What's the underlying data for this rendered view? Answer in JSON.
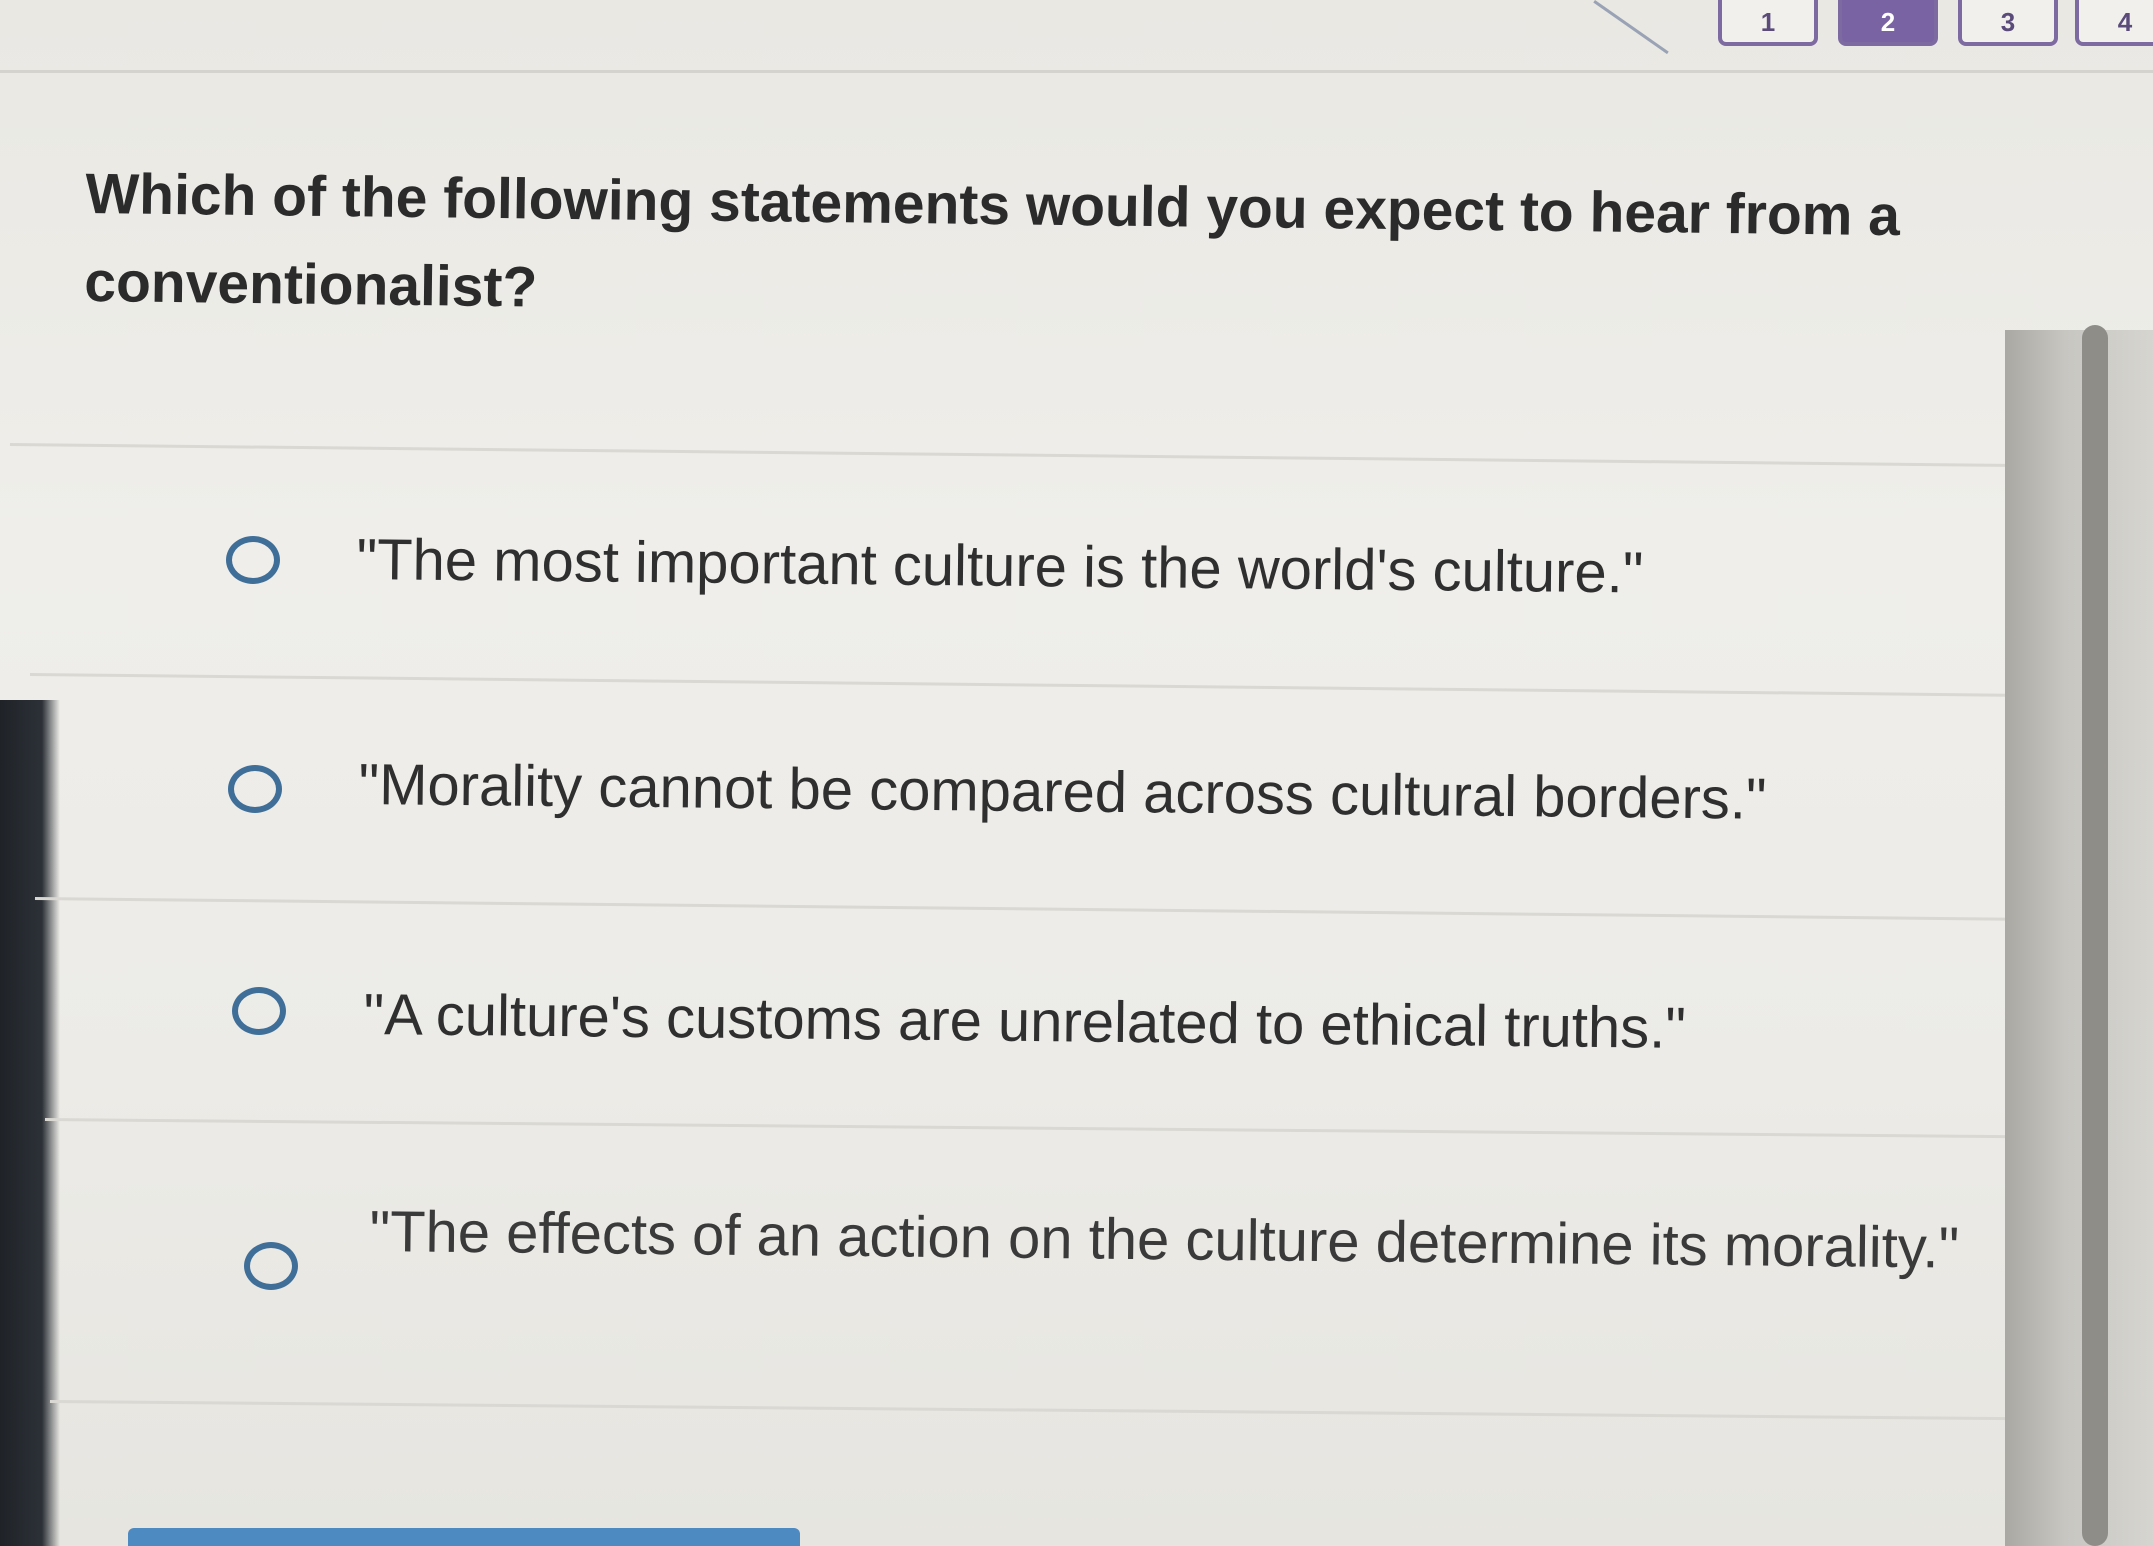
{
  "nav": {
    "question_numbers": [
      "1",
      "2",
      "3",
      "4"
    ],
    "active_index": 1
  },
  "question": {
    "text": "Which of the following statements would you expect to hear from a conventionalist?"
  },
  "options": [
    {
      "text": "\"The most important culture is the world's culture.\"",
      "selected": false
    },
    {
      "text": "\"Morality cannot be compared across cultural borders.\"",
      "selected": false
    },
    {
      "text": "\"A culture's customs are unrelated to ethical truths.\"",
      "selected": false
    },
    {
      "text": "\"The effects of an action on the culture determine its morality.\"",
      "selected": false
    }
  ],
  "colors": {
    "radio_border": "#3f6f99",
    "active_question_box": "#7a63a3",
    "text": "#2b2b2b"
  }
}
